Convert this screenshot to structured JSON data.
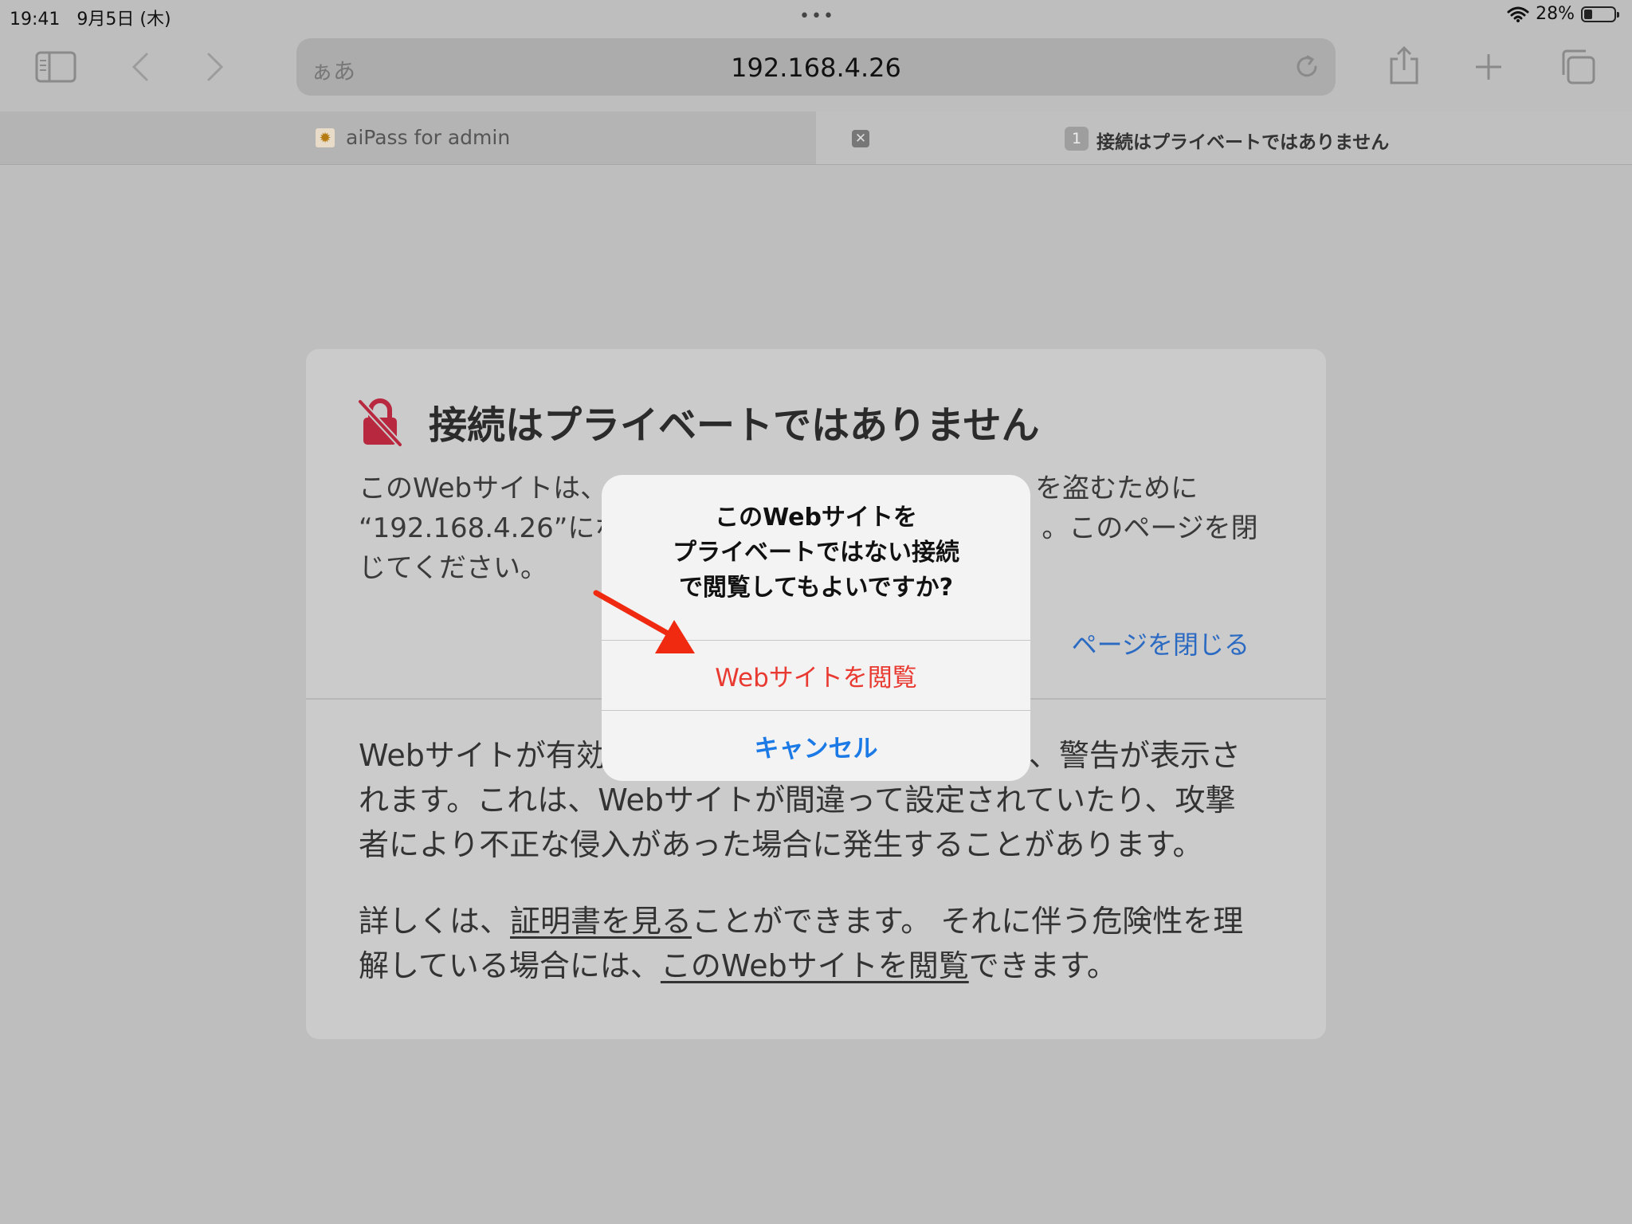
{
  "status_bar": {
    "time": "19:41",
    "date": "9月5日 (木)",
    "dots": "•••",
    "battery": "28%",
    "battery_fraction": 0.28
  },
  "toolbar": {
    "address_aa": "ぁあ",
    "url": "192.168.4.26"
  },
  "tabs": [
    {
      "title": "aiPass for admin",
      "favicon": "sun-icon"
    },
    {
      "badge": "1",
      "title": "接続はプライベートではありません"
    }
  ],
  "error_page": {
    "title": "接続はプライベートではありません",
    "desc_line1": "このWebサイトは、",
    "desc_line1_end": "を盗むために",
    "desc_line2": "“192.168.4.26”にな",
    "desc_line2_end": "。このページを閉",
    "desc_line3": "じてください。",
    "close_link": "ページを閉じる",
    "body_line1": "Webサイトが有効",
    "body_line1_end": "、警告が表示さ",
    "body_line2": "れます。これは、Webサイトが間違って設定されていたり、攻撃",
    "body_line3": "者により不正な侵入があった場合に発生することがあります。",
    "details_prefix": "詳しくは、",
    "details_link1": "証明書を見る",
    "details_mid": "ことができます。 それに伴う危険性を理",
    "details_line2_prefix": "解している場合には、",
    "details_link2": "このWebサイトを閲覧",
    "details_suffix": "できます。"
  },
  "alert": {
    "title_line1": "このWebサイトを",
    "title_line2": "プライベートではない接続",
    "title_line3": "で閲覧してもよいですか?",
    "visit_button": "Webサイトを閲覧",
    "cancel_button": "キャンセル"
  },
  "colors": {
    "alert_destructive": "#e93a32",
    "link_blue": "#1b7ae6",
    "arrow_red": "#f02a10",
    "lock_red": "#b8283f"
  }
}
